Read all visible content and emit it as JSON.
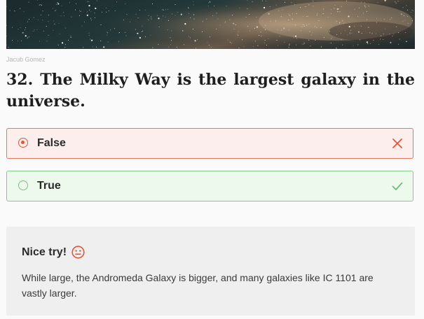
{
  "image": {
    "credit": "Jacub Gomez"
  },
  "question": {
    "number": "32.",
    "text": "The Milky Way is the largest galaxy in the universe."
  },
  "options": [
    {
      "label": "False",
      "state": "selected-incorrect",
      "mark_icon": "close-icon",
      "color": "#e0563a"
    },
    {
      "label": "True",
      "state": "correct",
      "mark_icon": "check-icon",
      "color": "#6cbf72"
    }
  ],
  "feedback": {
    "title": "Nice try!",
    "icon": "neutral-face-icon",
    "text": "While large, the Andromeda Galaxy is bigger, and many galaxies like IC 1101 are vastly larger."
  }
}
